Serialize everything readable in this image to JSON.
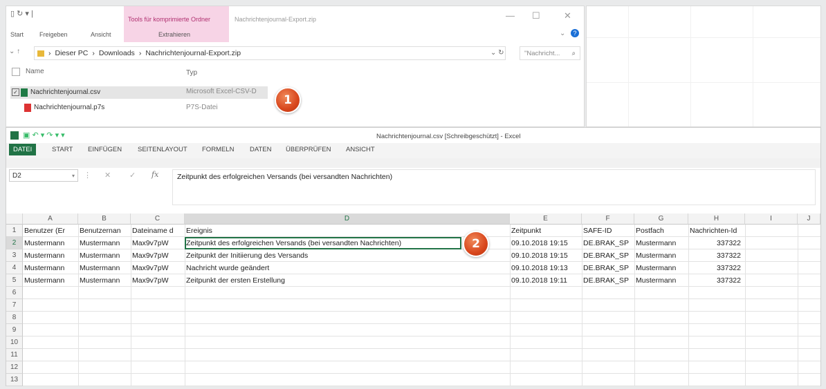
{
  "explorer": {
    "context_tab": "Tools für komprimierte Ordner",
    "window_title": "Nachrichtenjournal-Export.zip",
    "ribbon_tabs": [
      "Start",
      "Freigeben",
      "Ansicht"
    ],
    "ribbon_sub": "Extrahieren",
    "breadcrumb": [
      "Dieser PC",
      "Downloads",
      "Nachrichtenjournal-Export.zip"
    ],
    "search_placeholder": "\"Nachricht...",
    "columns": {
      "name": "Name",
      "type": "Typ"
    },
    "files": [
      {
        "name": "Nachrichtenjournal.csv",
        "type": "Microsoft Excel-CSV-D"
      },
      {
        "name": "Nachrichtenjournal.p7s",
        "type": "P7S-Datei"
      }
    ],
    "badge": "1"
  },
  "excel": {
    "title": "Nachrichtenjournal.csv  [Schreibgeschützt] - Excel",
    "tabs": [
      "DATEI",
      "START",
      "EINFÜGEN",
      "SEITENLAYOUT",
      "FORMELN",
      "DATEN",
      "ÜBERPRÜFEN",
      "ANSICHT"
    ],
    "name_box": "D2",
    "fx": "fx",
    "formula": "Zeitpunkt des erfolgreichen Versands (bei versandten Nachrichten)",
    "col_letters": [
      "A",
      "B",
      "C",
      "D",
      "E",
      "F",
      "G",
      "H",
      "I",
      "J"
    ],
    "row_numbers": [
      "1",
      "2",
      "3",
      "4",
      "5",
      "6",
      "7",
      "8",
      "9",
      "10",
      "11",
      "12",
      "13"
    ],
    "rows": [
      [
        "Benutzer (Er",
        "Benutzernan",
        "Dateiname d",
        "Ereignis",
        "Zeitpunkt",
        "SAFE-ID",
        "Postfach",
        "Nachrichten-Id"
      ],
      [
        "Mustermann",
        "Mustermann",
        "Max9v7pW",
        "Zeitpunkt des erfolgreichen Versands (bei versandten Nachrichten)",
        "09.10.2018 19:15",
        "DE.BRAK_SP",
        "Mustermann",
        "337322"
      ],
      [
        "Mustermann",
        "Mustermann",
        "Max9v7pW",
        "Zeitpunkt der Initiierung des Versands",
        "09.10.2018 19:15",
        "DE.BRAK_SP",
        "Mustermann",
        "337322"
      ],
      [
        "Mustermann",
        "Mustermann",
        "Max9v7pW",
        "Nachricht wurde geändert",
        "09.10.2018 19:13",
        "DE.BRAK_SP",
        "Mustermann",
        "337322"
      ],
      [
        "Mustermann",
        "Mustermann",
        "Max9v7pW",
        "Zeitpunkt der ersten Erstellung",
        "09.10.2018 19:11",
        "DE.BRAK_SP",
        "Mustermann",
        "337322"
      ]
    ],
    "badge": "2"
  }
}
